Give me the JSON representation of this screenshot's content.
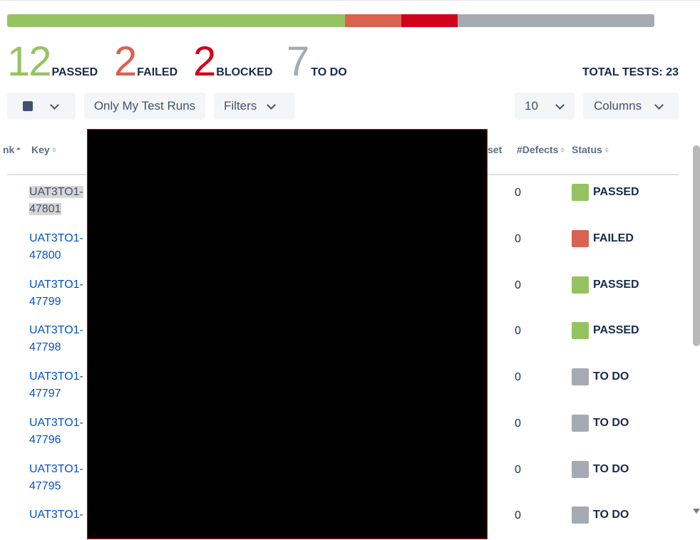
{
  "summary": {
    "passed": {
      "count": "12",
      "label": "PASSED",
      "color": "#96c362"
    },
    "failed": {
      "count": "2",
      "label": "FAILED",
      "color": "#d96251"
    },
    "blocked": {
      "count": "2",
      "label": "BLOCKED",
      "color": "#d0021b"
    },
    "todo": {
      "count": "7",
      "label": "TO DO",
      "color": "#a5aab3"
    },
    "total_label": "TOTAL TESTS: 23"
  },
  "progress": {
    "passed": 12,
    "failed": 2,
    "blocked": 2,
    "todo": 7
  },
  "toolbar": {
    "only_my_label": "Only My Test Runs",
    "filters_label": "Filters",
    "page_size": "10",
    "columns_label": "Columns"
  },
  "table": {
    "headers": {
      "rank": "nk",
      "key": "Key",
      "dataset": "set",
      "defects": "#Defects",
      "status": "Status"
    },
    "rows": [
      {
        "key1": "UAT3TO1-",
        "key2": "47801",
        "defects": "0",
        "status": "PASSED",
        "color": "#96c362"
      },
      {
        "key1": "UAT3TO1-",
        "key2": "47800",
        "defects": "0",
        "status": "FAILED",
        "color": "#d96251"
      },
      {
        "key1": "UAT3TO1-",
        "key2": "47799",
        "defects": "0",
        "status": "PASSED",
        "color": "#96c362"
      },
      {
        "key1": "UAT3TO1-",
        "key2": "47798",
        "defects": "0",
        "status": "PASSED",
        "color": "#96c362"
      },
      {
        "key1": "UAT3TO1-",
        "key2": "47797",
        "defects": "0",
        "status": "TO DO",
        "color": "#a5aab3"
      },
      {
        "key1": "UAT3TO1-",
        "key2": "47796",
        "defects": "0",
        "status": "TO DO",
        "color": "#a5aab3"
      },
      {
        "key1": "UAT3TO1-",
        "key2": "47795",
        "defects": "0",
        "status": "TO DO",
        "color": "#a5aab3"
      },
      {
        "key1": "UAT3TO1-",
        "key2": "",
        "defects": "0",
        "status": "TO DO",
        "color": "#a5aab3"
      }
    ]
  }
}
